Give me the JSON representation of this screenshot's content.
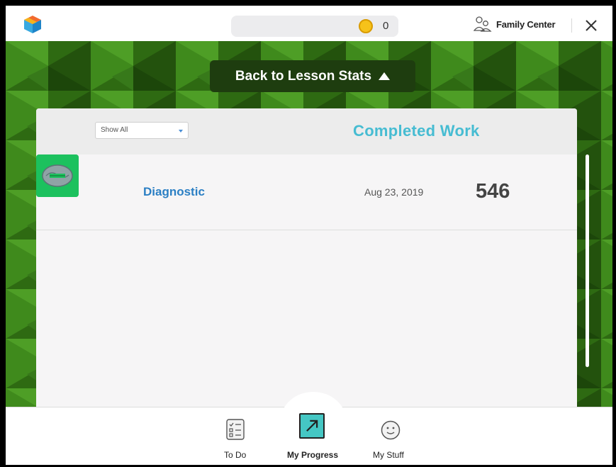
{
  "topbar": {
    "coins": "0",
    "family_center_label": "Family Center"
  },
  "back_button": {
    "label": "Back to Lesson Stats"
  },
  "panel": {
    "filter": {
      "selected": "Show All"
    },
    "heading": "Completed Work",
    "rows": [
      {
        "title": "Diagnostic",
        "date": "Aug 23, 2019",
        "score": "546"
      }
    ]
  },
  "bottom_nav": {
    "items": [
      {
        "label": "To Do",
        "icon": "checklist-icon"
      },
      {
        "label": "My Progress",
        "icon": "progress-arrow-icon",
        "active": true
      },
      {
        "label": "My Stuff",
        "icon": "smiley-icon"
      }
    ]
  },
  "colors": {
    "accent_teal": "#46bcd2",
    "link_blue": "#2b7fc4",
    "background_green": "#2f6b14",
    "thumb_green": "#1cc15e"
  }
}
